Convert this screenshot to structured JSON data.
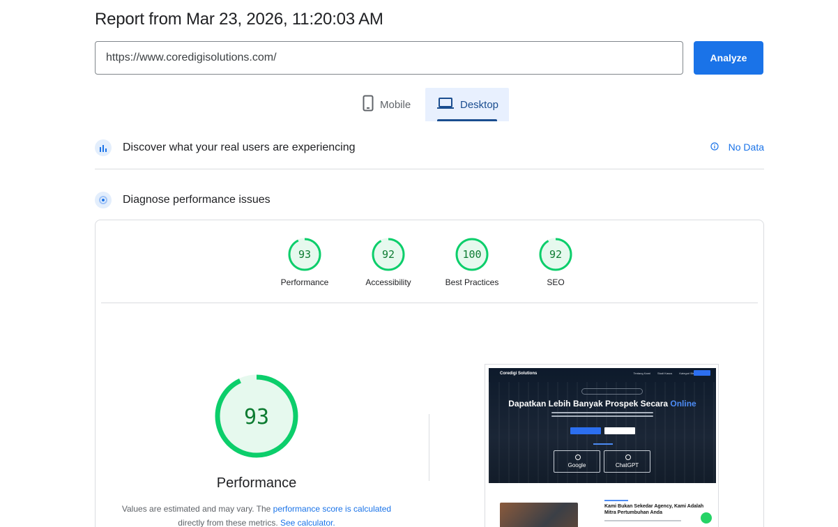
{
  "report": {
    "title": "Report from Mar 23, 2026, 11:20:03 AM"
  },
  "url_input": {
    "value": "https://www.coredigisolutions.com/"
  },
  "analyze": {
    "label": "Analyze"
  },
  "tabs": [
    {
      "label": "Mobile",
      "icon": "smartphone-icon",
      "selected": false
    },
    {
      "label": "Desktop",
      "icon": "laptop-icon",
      "selected": true
    }
  ],
  "field_data": {
    "title": "Discover what your real users are experiencing",
    "status": "No Data",
    "status_icon": "info-icon"
  },
  "lab_data": {
    "title": "Diagnose performance issues"
  },
  "scores": [
    {
      "label": "Performance",
      "score": "93",
      "value": 93
    },
    {
      "label": "Accessibility",
      "score": "92",
      "value": 92
    },
    {
      "label": "Best Practices",
      "score": "100",
      "value": 100
    },
    {
      "label": "SEO",
      "score": "92",
      "value": 92
    }
  ],
  "colors": {
    "pass": "#0cce6b",
    "pass_fill": "#e6f9ee",
    "pass_text": "#0c7b31",
    "accent": "#1a73e8",
    "tab_selected": "#1a4d8f"
  },
  "detail": {
    "score": "93",
    "value": 93,
    "label": "Performance",
    "note_prefix": "Values are estimated and may vary. The ",
    "note_link1": "performance score is calculated",
    "note_mid": " directly from these metrics. ",
    "note_link2": "See calculator."
  },
  "screenshot": {
    "brand": "Coredigi Solutions",
    "nav": [
      "Tentang Kami",
      "Studi Kasus",
      "Kategori Bisnis"
    ],
    "headline": "Dapatkan Lebih Banyak Prospek Secara",
    "headline_accent": "Online",
    "card1": "Google",
    "card2": "ChatGPT",
    "section_heading": "Kami Bukan Sekedar Agency, Kami Adalah Mitra Pertumbuhan Anda"
  }
}
